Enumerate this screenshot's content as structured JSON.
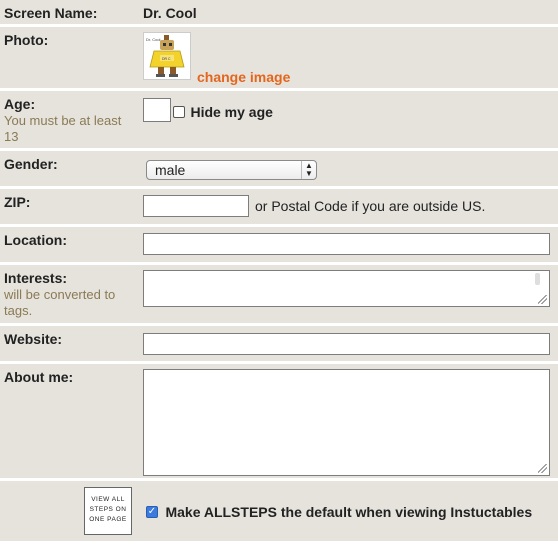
{
  "screen_name": {
    "label": "Screen Name:",
    "value": "Dr. Cool"
  },
  "photo": {
    "label": "Photo:",
    "change_link": "change image",
    "avatar_caption": "Dr. Cool",
    "avatar_badge": "DR C"
  },
  "age": {
    "label": "Age:",
    "hint": "You must be at least 13",
    "value": "",
    "hide_label": "Hide my age",
    "hide_checked": false
  },
  "gender": {
    "label": "Gender:",
    "selected": "male"
  },
  "zip": {
    "label": "ZIP:",
    "value": "",
    "note": "or Postal Code if you are outside US."
  },
  "location": {
    "label": "Location:",
    "value": ""
  },
  "interests": {
    "label": "Interests:",
    "hint": "will be converted to tags.",
    "value": ""
  },
  "website": {
    "label": "Website:",
    "value": ""
  },
  "about": {
    "label": "About me:",
    "value": ""
  },
  "allsteps": {
    "icon_text": [
      "VIEW ALL",
      "STEPS ON",
      "ONE PAGE"
    ],
    "checkbox_label": "Make ALLSTEPS the default when viewing Instuctables",
    "checked": true
  },
  "colors": {
    "link": "#e4661d",
    "row_bg": "#e6e3dd",
    "hint": "#8a7a55",
    "checkbox": "#3b7be0"
  }
}
